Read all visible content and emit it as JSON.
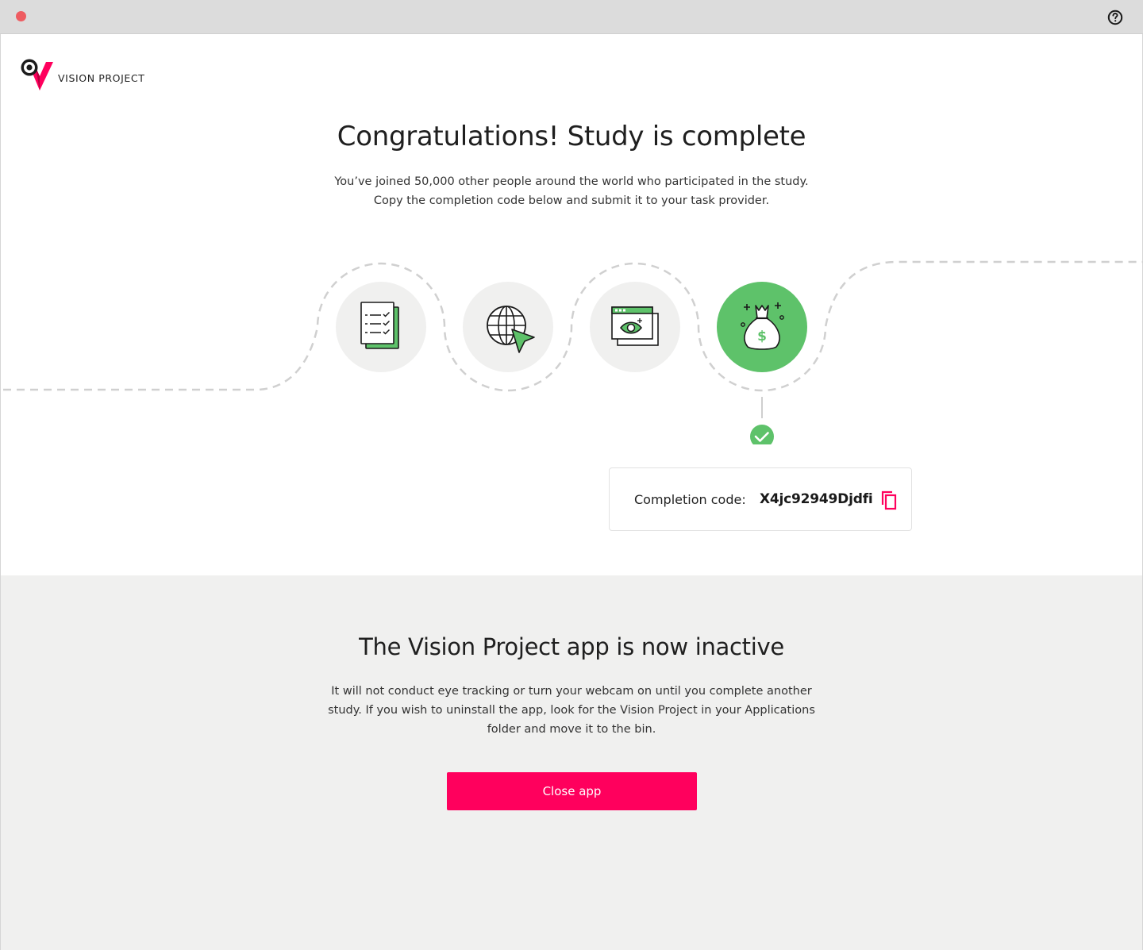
{
  "window": {
    "close_color": "#ee5c61",
    "help_icon": "help-circle-icon"
  },
  "brand": {
    "name": "VISION PROJECT",
    "accent": "#ff005d",
    "success": "#5ec26a"
  },
  "completion": {
    "title": "Congratulations! Study is complete",
    "line1": "You’ve joined 50,000 other people around the world  who participated in the study.",
    "line2": "Copy the completion code below and submit it to your task provider.",
    "steps": [
      {
        "icon": "checklist-icon",
        "active": false
      },
      {
        "icon": "globe-cursor-icon",
        "active": false
      },
      {
        "icon": "eye-tracking-window-icon",
        "active": false
      },
      {
        "icon": "money-bag-icon",
        "active": true
      }
    ],
    "code_label": "Completion code:",
    "code_value": "X4jc92949Djdfi",
    "copy_icon": "copy-icon"
  },
  "inactive": {
    "title": "The Vision Project app is now inactive",
    "line1": "It will not conduct eye tracking or turn your webcam on until you complete another",
    "line2": "study. If you wish to uninstall the app, look for the Vision Project in your Applications",
    "line3": "folder and move it to the bin.",
    "close_label": "Close app"
  }
}
